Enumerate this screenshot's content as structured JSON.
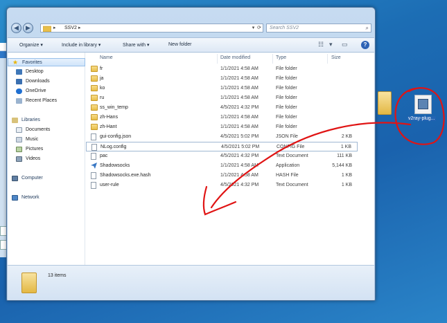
{
  "address": {
    "path": "SSV2",
    "search_placeholder": "Search SSV2"
  },
  "toolbar": {
    "organize": "Organize ▾",
    "include_in_library": "Include in library ▾",
    "share_with": "Share with ▾",
    "new_folder": "New folder"
  },
  "sidebar": {
    "favorites": "Favorites",
    "desktop": "Desktop",
    "downloads": "Downloads",
    "onedrive": "OneDrive",
    "recent_places": "Recent Places",
    "libraries": "Libraries",
    "documents": "Documents",
    "music": "Music",
    "pictures": "Pictures",
    "videos": "Videos",
    "computer": "Computer",
    "network": "Network"
  },
  "columns": {
    "name": "Name",
    "date_modified": "Date modified",
    "type": "Type",
    "size": "Size"
  },
  "files": [
    {
      "name": "fr",
      "date": "1/1/2021 4:58 AM",
      "type": "File folder",
      "size": "",
      "kind": "folder"
    },
    {
      "name": "ja",
      "date": "1/1/2021 4:58 AM",
      "type": "File folder",
      "size": "",
      "kind": "folder"
    },
    {
      "name": "ko",
      "date": "1/1/2021 4:58 AM",
      "type": "File folder",
      "size": "",
      "kind": "folder"
    },
    {
      "name": "ru",
      "date": "1/1/2021 4:58 AM",
      "type": "File folder",
      "size": "",
      "kind": "folder"
    },
    {
      "name": "ss_win_temp",
      "date": "4/5/2021 4:32 PM",
      "type": "File folder",
      "size": "",
      "kind": "folder"
    },
    {
      "name": "zh-Hans",
      "date": "1/1/2021 4:58 AM",
      "type": "File folder",
      "size": "",
      "kind": "folder"
    },
    {
      "name": "zh-Hant",
      "date": "1/1/2021 4:58 AM",
      "type": "File folder",
      "size": "",
      "kind": "folder"
    },
    {
      "name": "gui-config.json",
      "date": "4/5/2021 5:02 PM",
      "type": "JSON File",
      "size": "2 KB",
      "kind": "doc"
    },
    {
      "name": "NLog.config",
      "date": "4/5/2021 5:02 PM",
      "type": "CONFIG File",
      "size": "1 KB",
      "kind": "doc"
    },
    {
      "name": "pac",
      "date": "4/5/2021 4:32 PM",
      "type": "Text Document",
      "size": "111 KB",
      "kind": "doc"
    },
    {
      "name": "Shadowsocks",
      "date": "1/1/2021 4:58 AM",
      "type": "Application",
      "size": "5,144 KB",
      "kind": "app"
    },
    {
      "name": "Shadowsocks.exe.hash",
      "date": "1/1/2021 4:58 AM",
      "type": "HASH File",
      "size": "1 KB",
      "kind": "doc"
    },
    {
      "name": "user-rule",
      "date": "4/5/2021 4:32 PM",
      "type": "Text Document",
      "size": "1 KB",
      "kind": "doc"
    }
  ],
  "status": {
    "items_count": "13 items"
  },
  "desktop": {
    "file_label": "v2ray-plug..."
  },
  "colors": {
    "annotation": "#e01414",
    "accent": "#2e63b5"
  }
}
